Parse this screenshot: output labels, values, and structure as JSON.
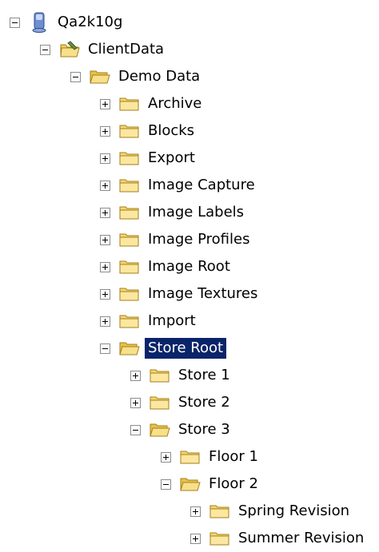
{
  "tree": {
    "nodes": [
      {
        "label": "Qa2k10g",
        "expanded": true,
        "icon": "server-icon"
      },
      {
        "label": "ClientData",
        "expanded": true,
        "icon": "database-folder-icon"
      },
      {
        "label": "Demo Data",
        "expanded": true,
        "icon": "folder-open-icon"
      },
      {
        "label": "Archive",
        "expanded": false,
        "icon": "folder-icon"
      },
      {
        "label": "Blocks",
        "expanded": false,
        "icon": "folder-icon"
      },
      {
        "label": "Export",
        "expanded": false,
        "icon": "folder-icon"
      },
      {
        "label": "Image Capture",
        "expanded": false,
        "icon": "folder-icon"
      },
      {
        "label": "Image Labels",
        "expanded": false,
        "icon": "folder-icon"
      },
      {
        "label": "Image Profiles",
        "expanded": false,
        "icon": "folder-icon"
      },
      {
        "label": "Image Root",
        "expanded": false,
        "icon": "folder-icon"
      },
      {
        "label": "Image Textures",
        "expanded": false,
        "icon": "folder-icon"
      },
      {
        "label": "Import",
        "expanded": false,
        "icon": "folder-icon"
      },
      {
        "label": "Store Root",
        "expanded": true,
        "selected": true,
        "icon": "folder-open-icon"
      },
      {
        "label": "Store 1",
        "expanded": false,
        "icon": "folder-icon"
      },
      {
        "label": "Store 2",
        "expanded": false,
        "icon": "folder-icon"
      },
      {
        "label": "Store 3",
        "expanded": true,
        "icon": "folder-open-icon"
      },
      {
        "label": "Floor 1",
        "expanded": false,
        "icon": "folder-icon"
      },
      {
        "label": "Floor 2",
        "expanded": true,
        "icon": "folder-open-icon"
      },
      {
        "label": "Spring Revision",
        "expanded": false,
        "icon": "folder-icon"
      },
      {
        "label": "Summer Revision",
        "expanded": false,
        "icon": "folder-icon"
      }
    ],
    "colors": {
      "selection": "#0a246a",
      "folder": "#f5d76e"
    }
  }
}
